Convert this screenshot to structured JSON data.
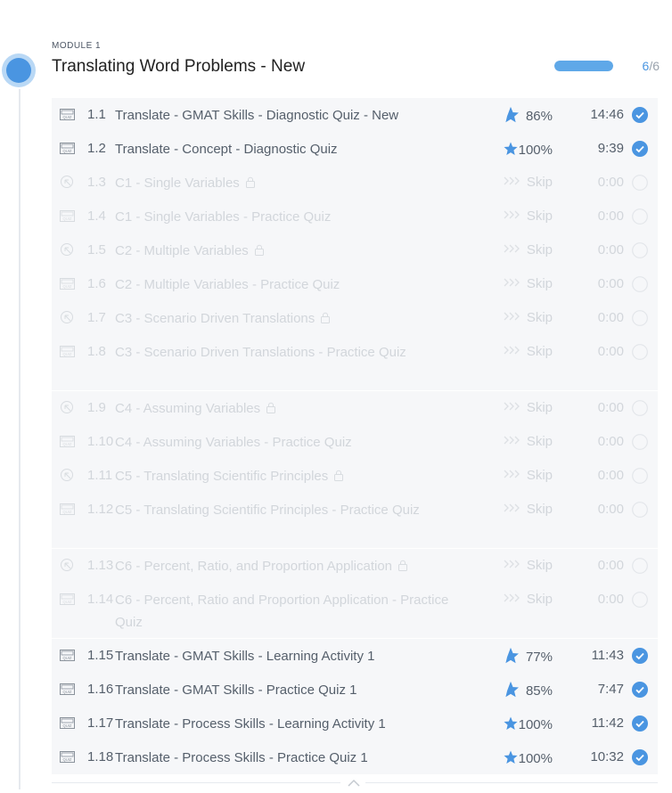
{
  "module": {
    "label": "MODULE 1",
    "title": "Translating Word Problems - New",
    "progress_done": "6",
    "progress_total": "/6",
    "progress_fraction": 1.0,
    "accent_color": "#4a95e1"
  },
  "rows": [
    {
      "num": "1.1",
      "title": "Translate - GMAT Skills - Diagnostic Quiz - New",
      "type": "quiz",
      "state": "done",
      "score": "86%",
      "time": "14:46"
    },
    {
      "num": "1.2",
      "title": "Translate - Concept - Diagnostic Quiz",
      "type": "quiz",
      "state": "done",
      "score": "100%",
      "time": "9:39"
    },
    {
      "num": "1.3",
      "title": "C1 - Single Variables",
      "type": "lesson",
      "state": "locked",
      "skip": "Skip",
      "time": "0:00"
    },
    {
      "num": "1.4",
      "title": "C1 - Single Variables - Practice Quiz",
      "type": "quiz",
      "state": "locked",
      "skip": "Skip",
      "time": "0:00"
    },
    {
      "num": "1.5",
      "title": "C2 - Multiple Variables",
      "type": "lesson",
      "state": "locked",
      "skip": "Skip",
      "time": "0:00"
    },
    {
      "num": "1.6",
      "title": "C2 - Multiple Variables - Practice Quiz",
      "type": "quiz",
      "state": "locked",
      "skip": "Skip",
      "time": "0:00"
    },
    {
      "num": "1.7",
      "title": "C3 - Scenario Driven Translations",
      "type": "lesson",
      "state": "locked",
      "skip": "Skip",
      "time": "0:00"
    },
    {
      "num": "1.8",
      "title": "C3 - Scenario Driven Translations - Practice Quiz",
      "type": "quiz",
      "state": "locked",
      "skip": "Skip",
      "time": "0:00"
    },
    {
      "num": "1.9",
      "title": "C4 - Assuming Variables",
      "type": "lesson",
      "state": "locked",
      "skip": "Skip",
      "time": "0:00"
    },
    {
      "num": "1.10",
      "title": "C4 - Assuming Variables - Practice Quiz",
      "type": "quiz",
      "state": "locked",
      "skip": "Skip",
      "time": "0:00"
    },
    {
      "num": "1.11",
      "title": "C5 - Translating Scientific Principles",
      "type": "lesson",
      "state": "locked",
      "skip": "Skip",
      "time": "0:00"
    },
    {
      "num": "1.12",
      "title": "C5 - Translating Scientific Principles - Practice Quiz",
      "type": "quiz",
      "state": "locked",
      "skip": "Skip",
      "time": "0:00"
    },
    {
      "num": "1.13",
      "title": "C6 - Percent, Ratio, and Proportion Application",
      "type": "lesson",
      "state": "locked",
      "skip": "Skip",
      "time": "0:00"
    },
    {
      "num": "1.14",
      "title": "C6 - Percent, Ratio and Proportion Application - Practice Quiz",
      "type": "quiz",
      "state": "locked",
      "skip": "Skip",
      "time": "0:00"
    },
    {
      "num": "1.15",
      "title": "Translate - GMAT Skills - Learning Activity 1",
      "type": "quiz",
      "state": "done",
      "score": "77%",
      "time": "11:43"
    },
    {
      "num": "1.16",
      "title": "Translate - GMAT Skills - Practice Quiz 1",
      "type": "quiz",
      "state": "done",
      "score": "85%",
      "time": "7:47"
    },
    {
      "num": "1.17",
      "title": "Translate - Process Skills - Learning Activity 1",
      "type": "quiz",
      "state": "done",
      "score": "100%",
      "time": "11:42"
    },
    {
      "num": "1.18",
      "title": "Translate - Process Skills - Practice Quiz 1",
      "type": "quiz",
      "state": "done",
      "score": "100%",
      "time": "10:32"
    }
  ],
  "icons": {
    "quiz": "quiz-icon",
    "lesson": "lesson-cursor-icon",
    "lock": "lock-icon",
    "score": "star-icon",
    "skip": "skip-chevrons-icon",
    "done": "check-circle-icon",
    "pending": "empty-circle-icon",
    "collapse": "chevron-up-icon"
  },
  "colors": {
    "star": "#4a95e1",
    "check": "#4a95e1",
    "locked_text": "#d2d6db",
    "row_bg": "#f6f7f9"
  }
}
